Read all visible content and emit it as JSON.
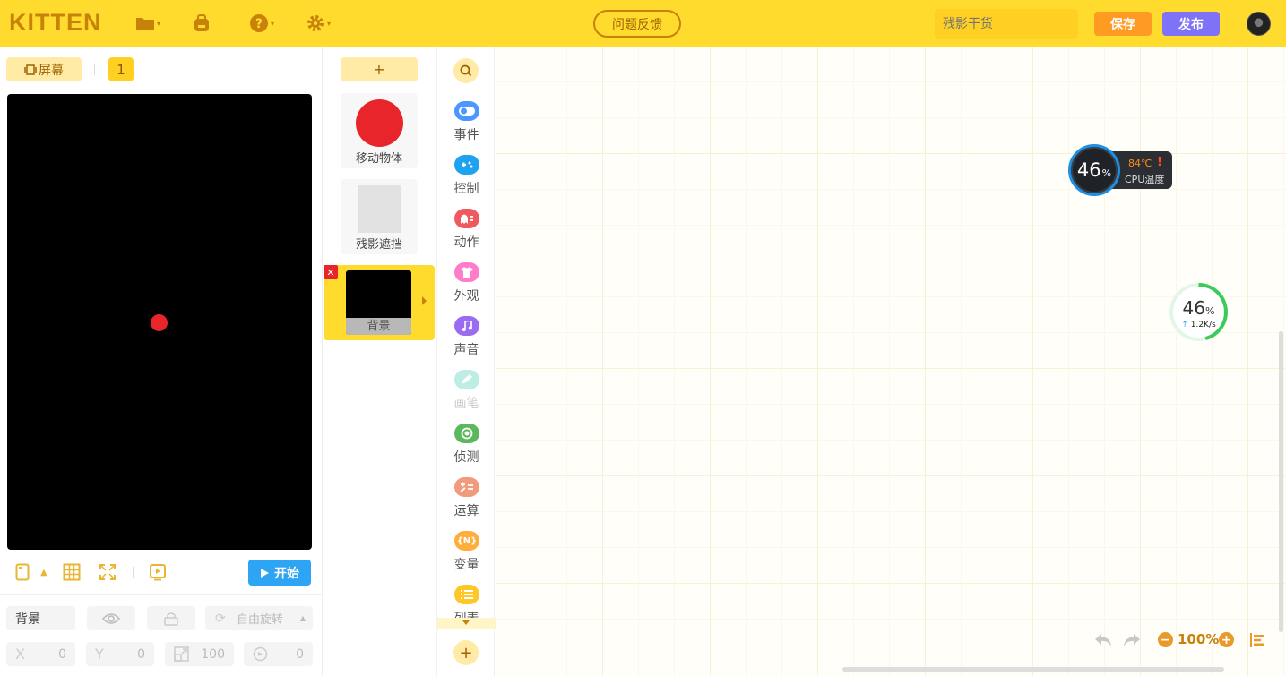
{
  "topbar": {
    "logo": "KITTEN",
    "feedback_label": "问题反馈",
    "title_placeholder": "残影干货",
    "save_label": "保存",
    "publish_label": "发布",
    "icons": [
      "folder-icon",
      "backpack-icon",
      "help-icon",
      "settings-icon"
    ]
  },
  "stage": {
    "screen_label": "屏幕",
    "page_number": "1",
    "start_label": "开始",
    "props": {
      "name": "背景",
      "rotate_label": "自由旋转",
      "x_key": "X",
      "x": "0",
      "y_key": "Y",
      "y": "0",
      "size": "100",
      "direction": "0"
    }
  },
  "sprites": {
    "add_label": "+",
    "items": [
      {
        "label": "移动物体",
        "color": "#E8252A"
      },
      {
        "label": "残影遮挡",
        "color": "#E2E2E2"
      }
    ],
    "background": {
      "label": "背景",
      "close": "✕"
    }
  },
  "categories": {
    "items": [
      {
        "label": "事件",
        "color": "#4C97FF",
        "icon": "toggle-icon"
      },
      {
        "label": "控制",
        "color": "#1FA2F0",
        "icon": "gamepad-icon"
      },
      {
        "label": "动作",
        "color": "#F0595D",
        "icon": "ghost-icon"
      },
      {
        "label": "外观",
        "color": "#FF7BCB",
        "icon": "shirt-icon"
      },
      {
        "label": "声音",
        "color": "#9B6CF2",
        "icon": "music-icon"
      },
      {
        "label": "画笔",
        "color": "#BDEDE4",
        "icon": "pen-icon",
        "disabled": true
      },
      {
        "label": "侦测",
        "color": "#5CB85C",
        "icon": "target-icon"
      },
      {
        "label": "运算",
        "color": "#F19B7E",
        "icon": "math-icon"
      },
      {
        "label": "变量",
        "color": "#FFAD3B",
        "icon": "variable-icon"
      },
      {
        "label": "列表",
        "color": "#FFC627",
        "icon": "list-icon"
      }
    ],
    "add_label": "+"
  },
  "workspace": {
    "zoom": "100%",
    "cpu": {
      "percent": "46",
      "pct_sign": "%",
      "temp": "84℃",
      "warn": "!",
      "label": "CPU温度"
    },
    "net": {
      "percent": "46",
      "pct_sign": "%",
      "speed_arrow": "↑",
      "speed": "1.2K/s",
      "fill_fraction": 0.46
    }
  }
}
